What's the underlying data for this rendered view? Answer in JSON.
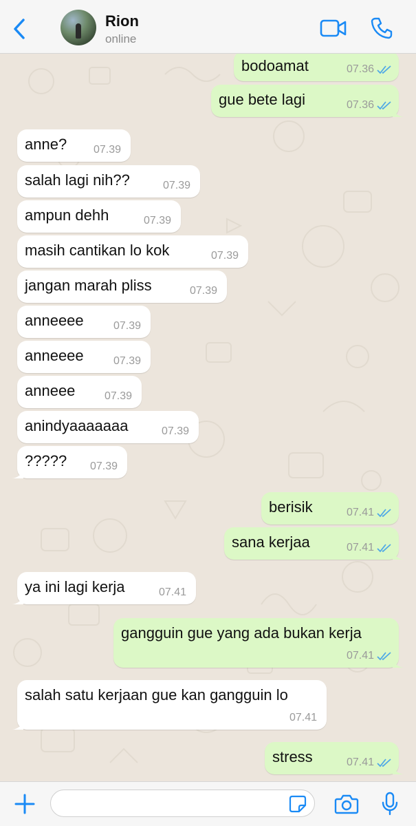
{
  "header": {
    "name": "Rion",
    "status": "online",
    "icons": {
      "back": "chevron-left-icon",
      "video": "video-camera-icon",
      "call": "phone-icon"
    },
    "accent": "#1a8af5"
  },
  "colors": {
    "incoming_bubble": "#ffffff",
    "outgoing_bubble": "#dcf8c6",
    "read_ticks": "#4fa8e6",
    "wallpaper": "#ece5dc"
  },
  "messages": [
    {
      "dir": "out",
      "text": "bodoamat",
      "time": "07.36",
      "read": true
    },
    {
      "dir": "out",
      "text": "gue bete lagi",
      "time": "07.36",
      "read": true
    },
    {
      "dir": "in",
      "text": "anne?",
      "time": "07.39"
    },
    {
      "dir": "in",
      "text": "salah lagi nih??",
      "time": "07.39"
    },
    {
      "dir": "in",
      "text": "ampun dehh",
      "time": "07.39"
    },
    {
      "dir": "in",
      "text": "masih cantikan lo kok",
      "time": "07.39"
    },
    {
      "dir": "in",
      "text": "jangan marah pliss",
      "time": "07.39"
    },
    {
      "dir": "in",
      "text": "anneeee",
      "time": "07.39"
    },
    {
      "dir": "in",
      "text": "anneeee",
      "time": "07.39"
    },
    {
      "dir": "in",
      "text": "anneee",
      "time": "07.39"
    },
    {
      "dir": "in",
      "text": "anindyaaaaaaa",
      "time": "07.39"
    },
    {
      "dir": "in",
      "text": "?????",
      "time": "07.39"
    },
    {
      "dir": "out",
      "text": "berisik",
      "time": "07.41",
      "read": true
    },
    {
      "dir": "out",
      "text": "sana kerjaa",
      "time": "07.41",
      "read": true
    },
    {
      "dir": "in",
      "text": "ya ini lagi kerja",
      "time": "07.41"
    },
    {
      "dir": "out",
      "text": "gangguin gue yang ada bukan kerja",
      "time": "07.41",
      "read": true
    },
    {
      "dir": "in",
      "text": "salah satu kerjaan gue kan gangguin lo",
      "time": "07.41"
    },
    {
      "dir": "out",
      "text": "stress",
      "time": "07.41",
      "read": true
    }
  ],
  "input": {
    "value": "",
    "placeholder": "",
    "icons": {
      "plus": "plus-icon",
      "sticker": "sticker-icon",
      "camera": "camera-icon",
      "mic": "microphone-icon"
    }
  }
}
